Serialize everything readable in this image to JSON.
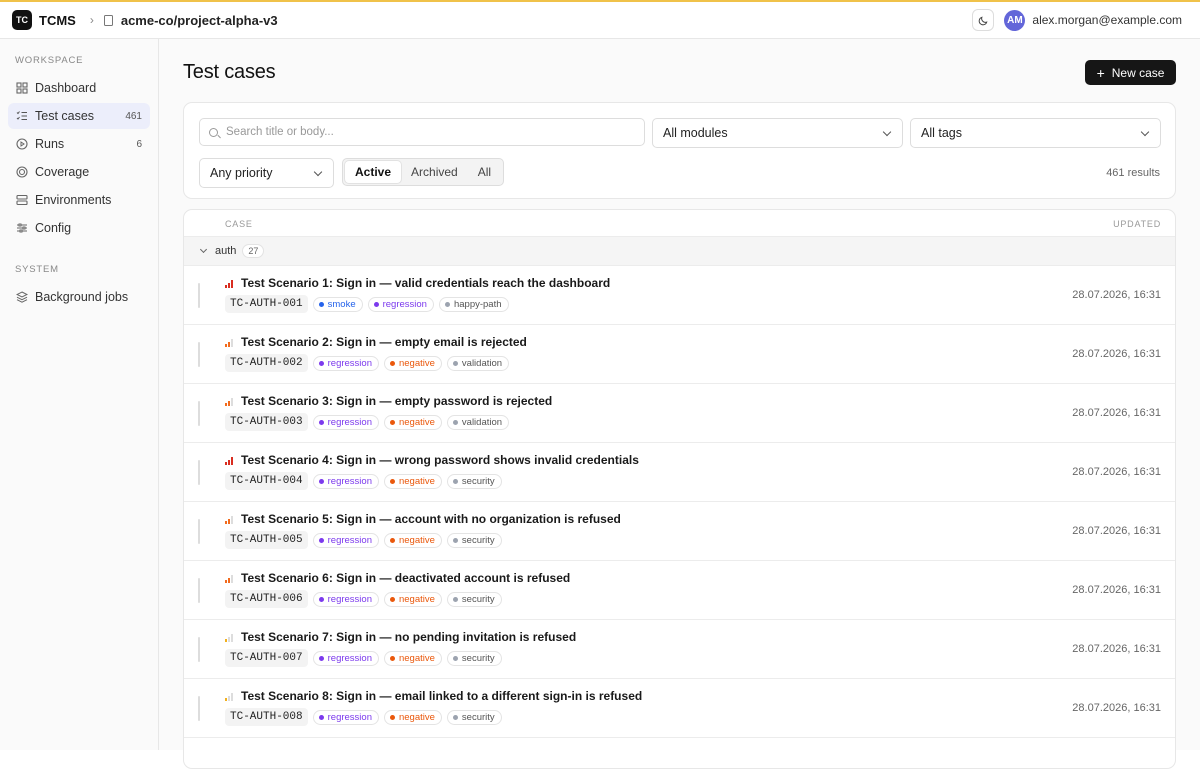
{
  "app": {
    "logo": "TC",
    "name": "TCMS",
    "repo": "acme-co/project-alpha-v3"
  },
  "user": {
    "initials": "AM",
    "email": "alex.morgan@example.com"
  },
  "colors": {
    "accent": "#6366d9",
    "high": "#d92d20",
    "medium": "#f26b1d",
    "low": "#f2b01e"
  },
  "sidebar": {
    "workspace_label": "WORKSPACE",
    "system_label": "SYSTEM",
    "items": [
      {
        "label": "Dashboard",
        "icon": "grid-icon",
        "count": ""
      },
      {
        "label": "Test cases",
        "icon": "list-check-icon",
        "count": "461"
      },
      {
        "label": "Runs",
        "icon": "play-circle-icon",
        "count": "6"
      },
      {
        "label": "Coverage",
        "icon": "target-icon",
        "count": ""
      },
      {
        "label": "Environments",
        "icon": "server-icon",
        "count": ""
      },
      {
        "label": "Config",
        "icon": "sliders-icon",
        "count": ""
      }
    ],
    "system_items": [
      {
        "label": "Background jobs",
        "icon": "layers-icon"
      }
    ]
  },
  "page": {
    "title": "Test cases",
    "new_button": "New case"
  },
  "filters": {
    "search_placeholder": "Search title or body...",
    "module": "All modules",
    "tags": "All tags",
    "priority": "Any priority",
    "status_options": [
      "Active",
      "Archived",
      "All"
    ],
    "status_selected": "Active",
    "results": "461 results"
  },
  "table": {
    "col_case": "CASE",
    "col_updated": "UPDATED",
    "group": {
      "name": "auth",
      "count": "27"
    },
    "rows": [
      {
        "title": "Test Scenario 1: Sign in — valid credentials reach the dashboard",
        "id": "TC-AUTH-001",
        "priority": "high",
        "tags": [
          {
            "label": "smoke",
            "color": "#2563eb"
          },
          {
            "label": "regression",
            "color": "#7c3aed"
          },
          {
            "label": "happy-path",
            "color": "#9ca3af"
          }
        ],
        "updated": "28.07.2026, 16:31"
      },
      {
        "title": "Test Scenario 2: Sign in — empty email is rejected",
        "id": "TC-AUTH-002",
        "priority": "medium",
        "tags": [
          {
            "label": "regression",
            "color": "#7c3aed"
          },
          {
            "label": "negative",
            "color": "#ea580c"
          },
          {
            "label": "validation",
            "color": "#9ca3af"
          }
        ],
        "updated": "28.07.2026, 16:31"
      },
      {
        "title": "Test Scenario 3: Sign in — empty password is rejected",
        "id": "TC-AUTH-003",
        "priority": "medium",
        "tags": [
          {
            "label": "regression",
            "color": "#7c3aed"
          },
          {
            "label": "negative",
            "color": "#ea580c"
          },
          {
            "label": "validation",
            "color": "#9ca3af"
          }
        ],
        "updated": "28.07.2026, 16:31"
      },
      {
        "title": "Test Scenario 4: Sign in — wrong password shows invalid credentials",
        "id": "TC-AUTH-004",
        "priority": "high",
        "tags": [
          {
            "label": "regression",
            "color": "#7c3aed"
          },
          {
            "label": "negative",
            "color": "#ea580c"
          },
          {
            "label": "security",
            "color": "#9ca3af"
          }
        ],
        "updated": "28.07.2026, 16:31"
      },
      {
        "title": "Test Scenario 5: Sign in — account with no organization is refused",
        "id": "TC-AUTH-005",
        "priority": "medium",
        "tags": [
          {
            "label": "regression",
            "color": "#7c3aed"
          },
          {
            "label": "negative",
            "color": "#ea580c"
          },
          {
            "label": "security",
            "color": "#9ca3af"
          }
        ],
        "updated": "28.07.2026, 16:31"
      },
      {
        "title": "Test Scenario 6: Sign in — deactivated account is refused",
        "id": "TC-AUTH-006",
        "priority": "medium",
        "tags": [
          {
            "label": "regression",
            "color": "#7c3aed"
          },
          {
            "label": "negative",
            "color": "#ea580c"
          },
          {
            "label": "security",
            "color": "#9ca3af"
          }
        ],
        "updated": "28.07.2026, 16:31"
      },
      {
        "title": "Test Scenario 7: Sign in — no pending invitation is refused",
        "id": "TC-AUTH-007",
        "priority": "low",
        "tags": [
          {
            "label": "regression",
            "color": "#7c3aed"
          },
          {
            "label": "negative",
            "color": "#ea580c"
          },
          {
            "label": "security",
            "color": "#9ca3af"
          }
        ],
        "updated": "28.07.2026, 16:31"
      },
      {
        "title": "Test Scenario 8: Sign in — email linked to a different sign-in is refused",
        "id": "TC-AUTH-008",
        "priority": "low",
        "tags": [
          {
            "label": "regression",
            "color": "#7c3aed"
          },
          {
            "label": "negative",
            "color": "#ea580c"
          },
          {
            "label": "security",
            "color": "#9ca3af"
          }
        ],
        "updated": "28.07.2026, 16:31"
      }
    ]
  }
}
